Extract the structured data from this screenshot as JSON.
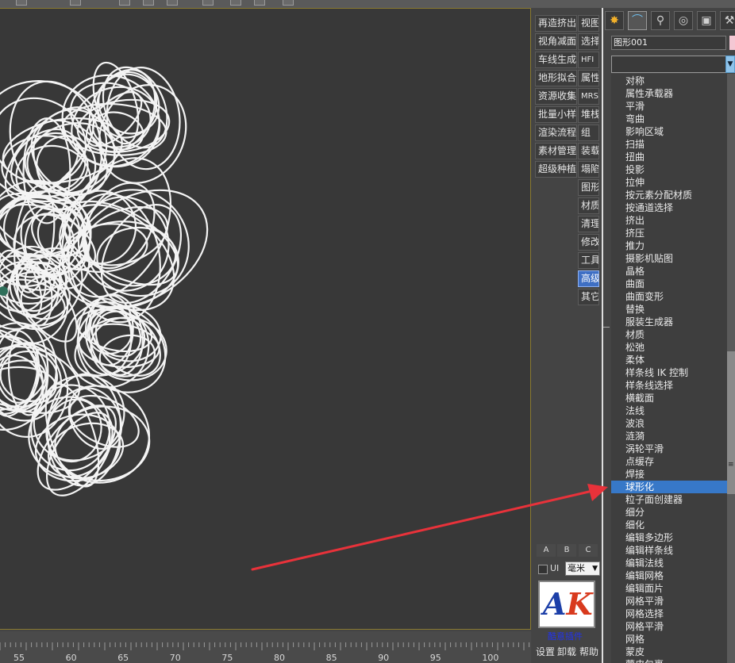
{
  "ruler": {
    "ticks": [
      "55",
      "60",
      "65",
      "70",
      "75",
      "80",
      "85",
      "90",
      "95",
      "100"
    ]
  },
  "plugin_toolbar": {
    "left_column": [
      "再造挤出",
      "视角减面",
      "车线生成",
      "地形拟合",
      "资源收集",
      "批量小样",
      "渲染流程",
      "素材管理",
      "超级种植"
    ],
    "right_column": [
      "视图",
      "选择",
      "HFI",
      "属性",
      "MRS",
      "堆栈",
      "组",
      "装载",
      "塌陷",
      "图形",
      "材质",
      "清理",
      "修改",
      "工具",
      "高级",
      "其它"
    ],
    "active_item": "高级",
    "abc_tabs": [
      "A",
      "B",
      "C"
    ],
    "ui_label": "UI",
    "unit_select": "毫米",
    "logo": {
      "letter1": "A",
      "letter2": "K"
    },
    "logo_caption": "酷意插件",
    "bottom_buttons": [
      "设置",
      "卸载",
      "帮助"
    ]
  },
  "command_panel": {
    "tabs": [
      {
        "icon": "create-sun-icon",
        "glyph": "✸"
      },
      {
        "icon": "modify-arc-icon",
        "glyph": "⌒"
      },
      {
        "icon": "hierarchy-icon",
        "glyph": "⚲"
      },
      {
        "icon": "motion-icon",
        "glyph": "◎"
      },
      {
        "icon": "display-monitor-icon",
        "glyph": "▣"
      },
      {
        "icon": "utilities-hammer-icon",
        "glyph": "⚒"
      }
    ],
    "object_name": "图形001",
    "modifier_list_value": "",
    "modifiers": [
      "对称",
      "属性承载器",
      "平滑",
      "弯曲",
      "影响区域",
      "扫描",
      "扭曲",
      "投影",
      "拉伸",
      "按元素分配材质",
      "按通道选择",
      "挤出",
      "挤压",
      "推力",
      "摄影机贴图",
      "晶格",
      "曲面",
      "曲面变形",
      "替换",
      "服装生成器",
      "材质",
      "松弛",
      "柔体",
      "样条线 IK 控制",
      "样条线选择",
      "横截面",
      "法线",
      "波浪",
      "涟漪",
      "涡轮平滑",
      "点缓存",
      "焊接",
      "球形化",
      "粒子面创建器",
      "细分",
      "细化",
      "编辑多边形",
      "编辑样条线",
      "编辑法线",
      "编辑网格",
      "编辑面片",
      "网格平滑",
      "网格选择",
      "网格平滑",
      "网格",
      "蒙皮",
      "蒙皮包裹"
    ],
    "selected_modifier": "球形化"
  },
  "colors": {
    "viewport_bg": "#383838",
    "selection_blue": "#3778c8",
    "annotation_arrow": "#e8323a",
    "viewport_border": "#8a7a30"
  }
}
